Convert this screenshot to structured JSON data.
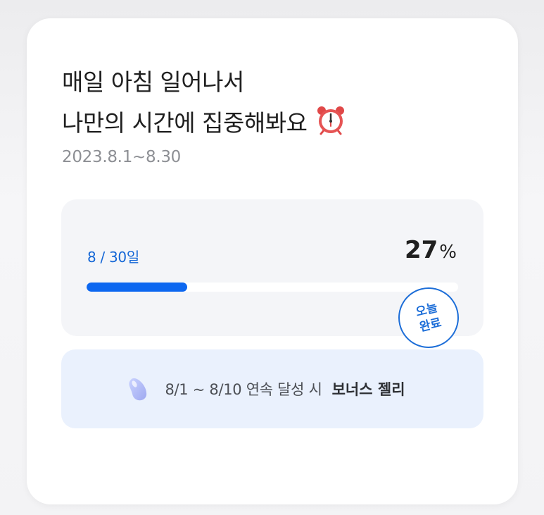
{
  "challenge": {
    "title_line1": "매일 아침 일어나서",
    "title_line2": "나만의 시간에 집중해봐요",
    "title_icon": "alarm-clock-icon",
    "period": "2023.8.1~8.30"
  },
  "progress": {
    "days_label": "8 / 30일",
    "percent_value": "27",
    "percent_unit": "%",
    "fill_fraction": 0.27,
    "stamp_line1": "오늘",
    "stamp_line2": "완료"
  },
  "bonus": {
    "icon": "jelly-bean-icon",
    "condition": "8/1 ~ 8/10 연속 달성 시",
    "reward": "보너스 젤리"
  },
  "colors": {
    "accent": "#0c67f0",
    "stamp": "#1d6ed8",
    "bonus_bg": "#eaf1fd",
    "panel_bg": "#f4f5f8"
  }
}
